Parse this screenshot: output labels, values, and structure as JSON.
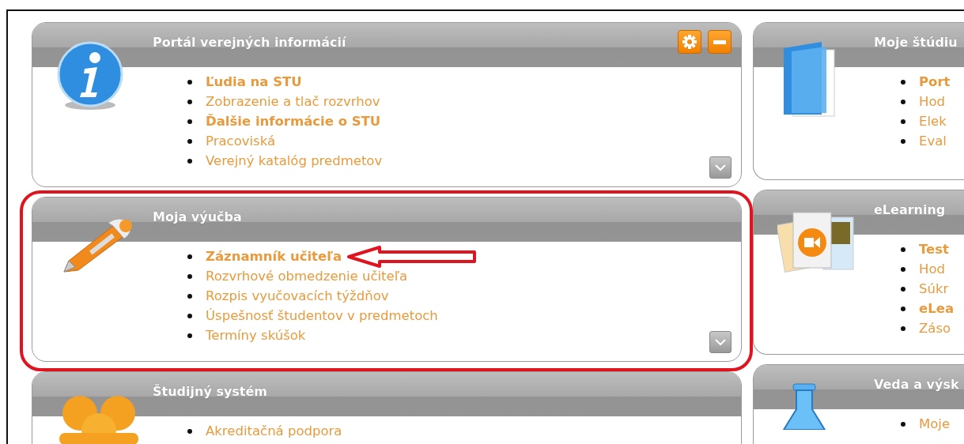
{
  "columns": [
    {
      "sections": [
        {
          "title": "Portál verejných informácií",
          "kind": "info",
          "controls": true,
          "expand_button": true,
          "highlighted": false,
          "items": [
            {
              "label": "Ľudia na STU",
              "bold": true,
              "pointed": false
            },
            {
              "label": "Zobrazenie a tlač rozvrhov",
              "bold": false,
              "pointed": false
            },
            {
              "label": "Ďalšie informácie o STU",
              "bold": true,
              "pointed": false
            },
            {
              "label": "Pracoviská",
              "bold": false,
              "pointed": false
            },
            {
              "label": "Verejný katalóg predmetov",
              "bold": false,
              "pointed": false
            }
          ]
        },
        {
          "title": "Moja výučba",
          "kind": "pen",
          "controls": false,
          "expand_button": true,
          "highlighted": true,
          "items": [
            {
              "label": "Záznamník učiteľa",
              "bold": true,
              "pointed": true
            },
            {
              "label": "Rozvrhové obmedzenie učiteľa",
              "bold": false,
              "pointed": false
            },
            {
              "label": "Rozpis vyučovacích týždňov",
              "bold": false,
              "pointed": false
            },
            {
              "label": "Úspešnosť študentov v predmetoch",
              "bold": false,
              "pointed": false
            },
            {
              "label": "Termíny skúšok",
              "bold": false,
              "pointed": false
            }
          ]
        },
        {
          "title": "Študijný systém",
          "kind": "people",
          "highlighted": false,
          "items": [
            {
              "label": "Akreditačná podpora",
              "bold": false,
              "pointed": false
            }
          ]
        }
      ]
    },
    {
      "sections": [
        {
          "title": "Moje štúdiu",
          "kind": "book",
          "highlighted": false,
          "items": [
            {
              "label": "Port",
              "bold": true,
              "pointed": false
            },
            {
              "label": "Hod",
              "bold": false,
              "pointed": false
            },
            {
              "label": "Elek",
              "bold": false,
              "pointed": false
            },
            {
              "label": "Eval",
              "bold": false,
              "pointed": false
            }
          ]
        },
        {
          "title": "eLearning",
          "kind": "media",
          "highlighted": false,
          "items": [
            {
              "label": "Test",
              "bold": true,
              "pointed": false
            },
            {
              "label": "Hod",
              "bold": false,
              "pointed": false
            },
            {
              "label": "Súkr",
              "bold": false,
              "pointed": false
            },
            {
              "label": "eLea",
              "bold": true,
              "pointed": false
            },
            {
              "label": "Záso",
              "bold": false,
              "pointed": false
            }
          ]
        },
        {
          "title": "Veda a výsk",
          "kind": "flask",
          "highlighted": false,
          "items": [
            {
              "label": "Moje",
              "bold": false,
              "pointed": false
            }
          ]
        }
      ]
    }
  ]
}
